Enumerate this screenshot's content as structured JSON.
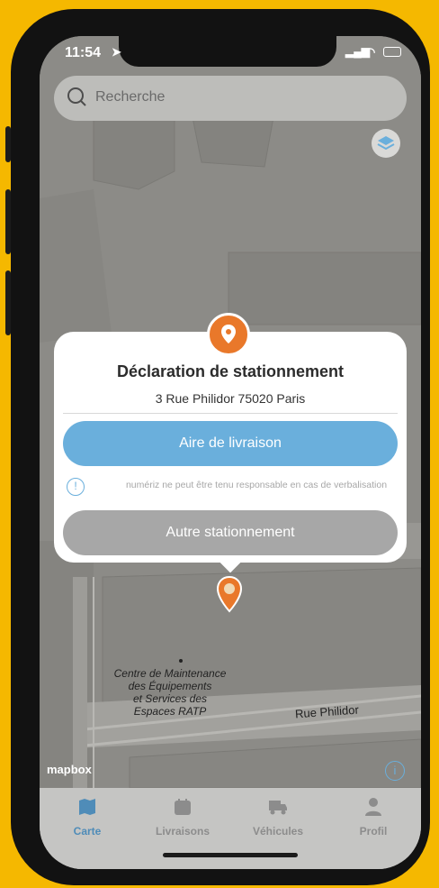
{
  "status_bar": {
    "time": "11:54"
  },
  "search": {
    "placeholder": "Recherche"
  },
  "map": {
    "labels": {
      "street": "Rue Philidor",
      "poi": "Centre de Maintenance\ndes Équipements\net Services des\nEspaces RATP",
      "attribution": "mapbox"
    }
  },
  "card": {
    "title": "Déclaration de stationnement",
    "address": "3 Rue Philidor 75020 Paris",
    "primary_button": "Aire de livraison",
    "disclaimer": "numériz ne peut être tenu responsable en cas de verbalisation",
    "secondary_button": "Autre stationnement"
  },
  "tabs": [
    {
      "label": "Carte",
      "icon": "map-icon",
      "active": true
    },
    {
      "label": "Livraisons",
      "icon": "calendar-icon",
      "active": false
    },
    {
      "label": "Véhicules",
      "icon": "truck-icon",
      "active": false
    },
    {
      "label": "Profil",
      "icon": "user-icon",
      "active": false
    }
  ],
  "colors": {
    "accent": "#6aafdc",
    "pin": "#e9782a",
    "frame": "#f5b800"
  }
}
